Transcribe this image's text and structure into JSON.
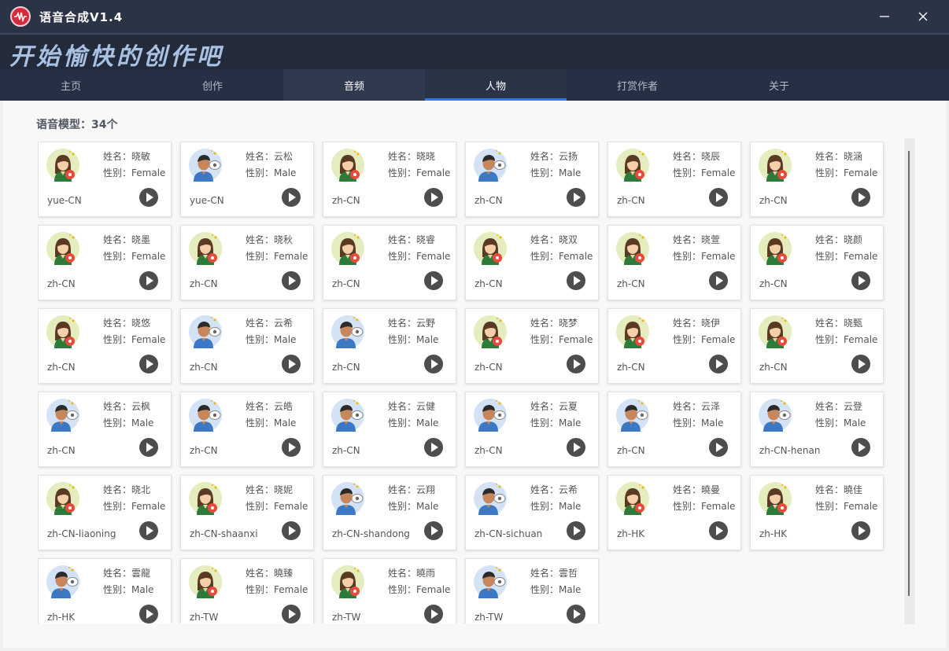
{
  "window": {
    "title": "语音合成V1.4",
    "minimize_glyph": "—",
    "close_glyph": "✕"
  },
  "banner": {
    "slogan": "开始愉快的创作吧"
  },
  "tabs": [
    {
      "label": "主页",
      "state": "normal"
    },
    {
      "label": "创作",
      "state": "normal"
    },
    {
      "label": "音频",
      "state": "dim"
    },
    {
      "label": "人物",
      "state": "active"
    },
    {
      "label": "打赏作者",
      "state": "normal"
    },
    {
      "label": "关于",
      "state": "normal"
    }
  ],
  "main": {
    "model_count": "语音模型：34个",
    "name_prefix": "姓名：",
    "gender_prefix": "性别：",
    "voices": [
      {
        "name": "晓敏",
        "gender": "Female",
        "locale": "yue-CN"
      },
      {
        "name": "云松",
        "gender": "Male",
        "locale": "yue-CN"
      },
      {
        "name": "晓晓",
        "gender": "Female",
        "locale": "zh-CN"
      },
      {
        "name": "云扬",
        "gender": "Male",
        "locale": "zh-CN"
      },
      {
        "name": "晓辰",
        "gender": "Female",
        "locale": "zh-CN"
      },
      {
        "name": "晓涵",
        "gender": "Female",
        "locale": "zh-CN"
      },
      {
        "name": "晓墨",
        "gender": "Female",
        "locale": "zh-CN"
      },
      {
        "name": "晓秋",
        "gender": "Female",
        "locale": "zh-CN"
      },
      {
        "name": "晓睿",
        "gender": "Female",
        "locale": "zh-CN"
      },
      {
        "name": "晓双",
        "gender": "Female",
        "locale": "zh-CN"
      },
      {
        "name": "晓萱",
        "gender": "Female",
        "locale": "zh-CN"
      },
      {
        "name": "晓颜",
        "gender": "Female",
        "locale": "zh-CN"
      },
      {
        "name": "晓悠",
        "gender": "Female",
        "locale": "zh-CN"
      },
      {
        "name": "云希",
        "gender": "Male",
        "locale": "zh-CN"
      },
      {
        "name": "云野",
        "gender": "Male",
        "locale": "zh-CN"
      },
      {
        "name": "晓梦",
        "gender": "Female",
        "locale": "zh-CN"
      },
      {
        "name": "晓伊",
        "gender": "Female",
        "locale": "zh-CN"
      },
      {
        "name": "晓甄",
        "gender": "Female",
        "locale": "zh-CN"
      },
      {
        "name": "云枫",
        "gender": "Male",
        "locale": "zh-CN"
      },
      {
        "name": "云皓",
        "gender": "Male",
        "locale": "zh-CN"
      },
      {
        "name": "云健",
        "gender": "Male",
        "locale": "zh-CN"
      },
      {
        "name": "云夏",
        "gender": "Male",
        "locale": "zh-CN"
      },
      {
        "name": "云泽",
        "gender": "Male",
        "locale": "zh-CN"
      },
      {
        "name": "云登",
        "gender": "Male",
        "locale": "zh-CN-henan"
      },
      {
        "name": "晓北",
        "gender": "Female",
        "locale": "zh-CN-liaoning"
      },
      {
        "name": "晓妮",
        "gender": "Female",
        "locale": "zh-CN-shaanxi"
      },
      {
        "name": "云翔",
        "gender": "Male",
        "locale": "zh-CN-shandong"
      },
      {
        "name": "云希",
        "gender": "Male",
        "locale": "zh-CN-sichuan"
      },
      {
        "name": "曉曼",
        "gender": "Female",
        "locale": "zh-HK"
      },
      {
        "name": "曉佳",
        "gender": "Female",
        "locale": "zh-HK"
      },
      {
        "name": "雲龍",
        "gender": "Male",
        "locale": "zh-HK"
      },
      {
        "name": "曉臻",
        "gender": "Female",
        "locale": "zh-TW"
      },
      {
        "name": "曉雨",
        "gender": "Female",
        "locale": "zh-TW"
      },
      {
        "name": "雲哲",
        "gender": "Male",
        "locale": "zh-TW"
      }
    ]
  }
}
